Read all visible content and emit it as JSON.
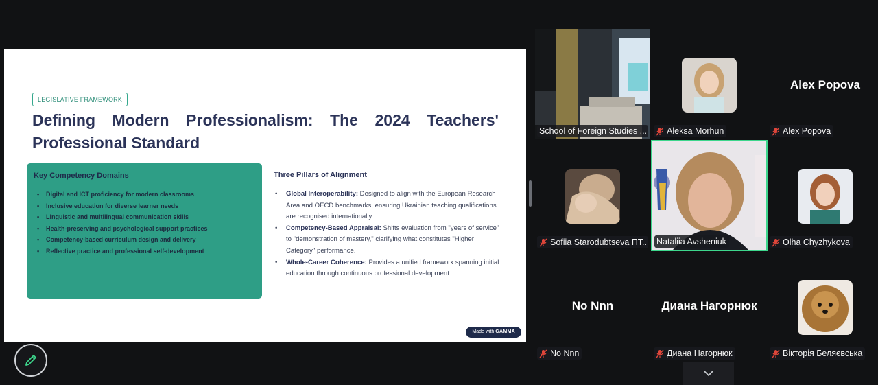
{
  "slide": {
    "tag": "LEGISLATIVE FRAMEWORK",
    "title": "Defining Modern Professionalism: The 2024 Teachers' Professional Standard",
    "card": {
      "heading": "Key Competency Domains",
      "items": [
        "Digital and ICT proficiency for modern classrooms",
        "Inclusive education for diverse learner needs",
        "Linguistic and multilingual communication skills",
        "Health-preserving and psychological support practices",
        "Competency-based curriculum design and delivery",
        "Reflective practice and professional self-development"
      ]
    },
    "pillars": {
      "heading": "Three Pillars of Alignment",
      "items": [
        {
          "term": "Global Interoperability:",
          "text": " Designed to align with the European Research Area and OECD benchmarks, ensuring Ukrainian teaching qualifications are recognised internationally."
        },
        {
          "term": "Competency-Based Appraisal:",
          "text": " Shifts evaluation from \"years of service\" to \"demonstration of mastery,\" clarifying what constitutes \"Higher Category\" performance."
        },
        {
          "term": "Whole-Career Coherence:",
          "text": " Provides a unified framework spanning initial education through continuous professional development."
        }
      ]
    },
    "badge_prefix": "Made with",
    "badge_brand": "GAMMA"
  },
  "participants": [
    {
      "id": "p1",
      "name": "School of Foreign Studies ...",
      "muted": false,
      "big_name": ""
    },
    {
      "id": "p2",
      "name": "Aleksa Morhun",
      "muted": true,
      "big_name": ""
    },
    {
      "id": "p3",
      "name": "Alex Popova",
      "muted": true,
      "big_name": "Alex Popova"
    },
    {
      "id": "p4",
      "name": "Sofiia Starodubtseva ПТ...",
      "muted": true,
      "big_name": ""
    },
    {
      "id": "p5",
      "name": "Nataliia Avsheniuk",
      "muted": false,
      "big_name": ""
    },
    {
      "id": "p6",
      "name": "Olha Chyzhykova",
      "muted": true,
      "big_name": ""
    },
    {
      "id": "p7",
      "name": "No Nnn",
      "muted": true,
      "big_name": "No Nnn"
    },
    {
      "id": "p8",
      "name": "Диана Нагорнюк",
      "muted": true,
      "big_name": "Диана Нагорнюк"
    },
    {
      "id": "p9",
      "name": "Вікторія Беляєвська",
      "muted": true,
      "big_name": ""
    }
  ],
  "colors": {
    "accent_active": "#3dd68c",
    "slide_green": "#2e9e86",
    "title_navy": "#2b3358"
  },
  "icons": {
    "annotate": "pen-icon",
    "scroll": "chevron-down-icon",
    "mic": "mic-off-icon"
  }
}
